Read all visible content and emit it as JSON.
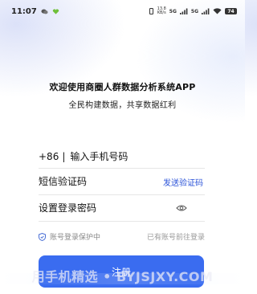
{
  "status_bar": {
    "time": "11:07",
    "left_icons": [
      "chat-icon",
      "heart-icon"
    ],
    "net_speed_value": "13.8",
    "net_speed_unit": "KB/s",
    "signal_tag_1": "5G",
    "signal_tag_2": "5G",
    "battery": "74"
  },
  "welcome": {
    "title": "欢迎使用商圈人群数据分析系统APP",
    "subtitle": "全民构建数据，共享数据红利"
  },
  "form": {
    "phone_prefix": "+86",
    "separator": "|",
    "phone_placeholder": "输入手机号码",
    "code_placeholder": "短信验证码",
    "send_code_label": "发送验证码",
    "password_placeholder": "设置登录密码"
  },
  "protection": {
    "label": "账号登录保护中",
    "login_link": "已有账号前往登录"
  },
  "register_button": "注册",
  "watermark": {
    "text_left": "用手机精选",
    "dot": "•",
    "text_right": "BYJSJXY.COM"
  },
  "colors": {
    "accent": "#3a6cf0",
    "link": "#2b53d8"
  }
}
